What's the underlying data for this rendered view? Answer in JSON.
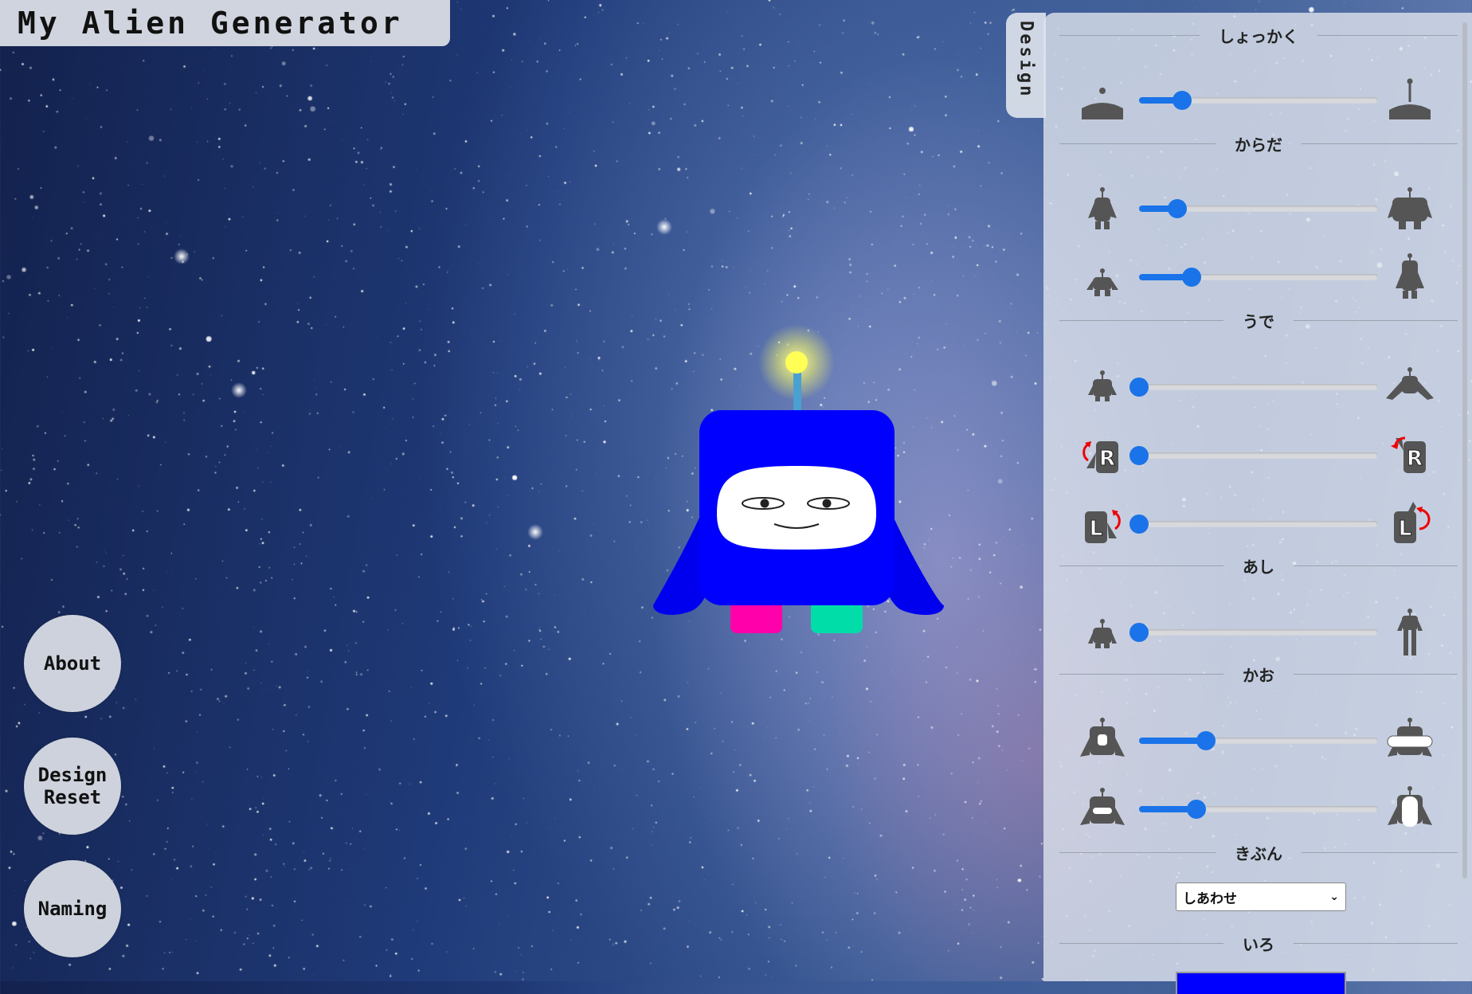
{
  "app": {
    "title": "My Alien Generator"
  },
  "buttons": {
    "about": "About",
    "design_reset": "Design\nReset",
    "naming": "Naming"
  },
  "panel": {
    "tab_label": "Design",
    "sections": {
      "shokkaku": "しょっかく",
      "karada": "からだ",
      "ude": "うで",
      "ashi": "あし",
      "kao": "かお",
      "kibun": "きぶん",
      "iro": "いろ"
    },
    "sliders": {
      "antenna": 0.18,
      "body_width": 0.16,
      "body_height": 0.22,
      "arm_size": 0.0,
      "arm_right_rotation": 0.0,
      "arm_left_rotation": 0.0,
      "leg_length": 0.0,
      "face_width": 0.28,
      "face_height": 0.24
    },
    "mood": {
      "selected": "しあわせ"
    },
    "color": {
      "value": "#0000ff"
    }
  },
  "alien": {
    "body_color": "#0000ff",
    "face_color": "#ffffff",
    "antenna_light_color": "#ffff66",
    "left_leg_color": "#ff00aa",
    "right_leg_color": "#00ddaa"
  },
  "icons": {
    "antenna_small": "antenna-small-icon",
    "antenna_large": "antenna-large-icon",
    "body_narrow": "body-narrow-icon",
    "body_wide": "body-wide-icon",
    "body_short": "body-short-icon",
    "body_tall": "body-tall-icon",
    "arm_small": "arm-small-icon",
    "arm_large": "arm-large-icon",
    "arm_right_rotate": "R",
    "arm_left_rotate": "L",
    "leg_short": "leg-short-icon",
    "leg_long": "leg-long-icon",
    "face_narrow": "face-narrow-icon",
    "face_wide": "face-wide-icon",
    "face_short": "face-short-icon",
    "face_tall": "face-tall-icon"
  }
}
